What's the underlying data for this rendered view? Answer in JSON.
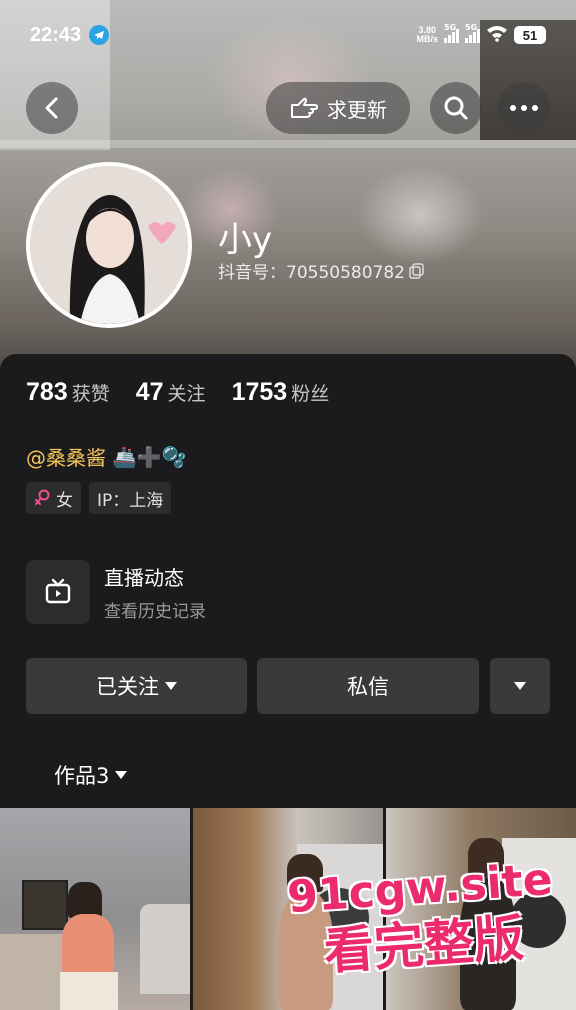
{
  "status_bar": {
    "time": "22:43",
    "net_speed_value": "3.80",
    "net_speed_unit": "MB/s",
    "signal1": "5G",
    "signal2": "5G",
    "battery": "51"
  },
  "nav": {
    "update_label": "求更新"
  },
  "profile": {
    "nickname": "小y",
    "douyin_id": "抖音号：70550580782"
  },
  "stats": [
    {
      "value": "783",
      "label": "获赞"
    },
    {
      "value": "47",
      "label": "关注"
    },
    {
      "value": "1753",
      "label": "粉丝"
    }
  ],
  "bio": {
    "mention": "@桑桑酱",
    "emoji": "🚢➕🫧"
  },
  "tags": {
    "gender": "女",
    "ip": "IP：上海"
  },
  "live": {
    "title": "直播动态",
    "subtitle": "查看历史记录"
  },
  "actions": {
    "follow_label": "已关注",
    "message_label": "私信"
  },
  "works": {
    "tab_label": "作品3"
  },
  "watermark": {
    "line1": "91cgw.site",
    "line2": "看完整版"
  },
  "colors": {
    "accent_gold": "#f4c45c",
    "gender_pink": "#f0508a",
    "watermark_pink": "#ec2a6e",
    "panel_bg": "#1b1b1d",
    "button_bg": "#3a3a3c"
  }
}
